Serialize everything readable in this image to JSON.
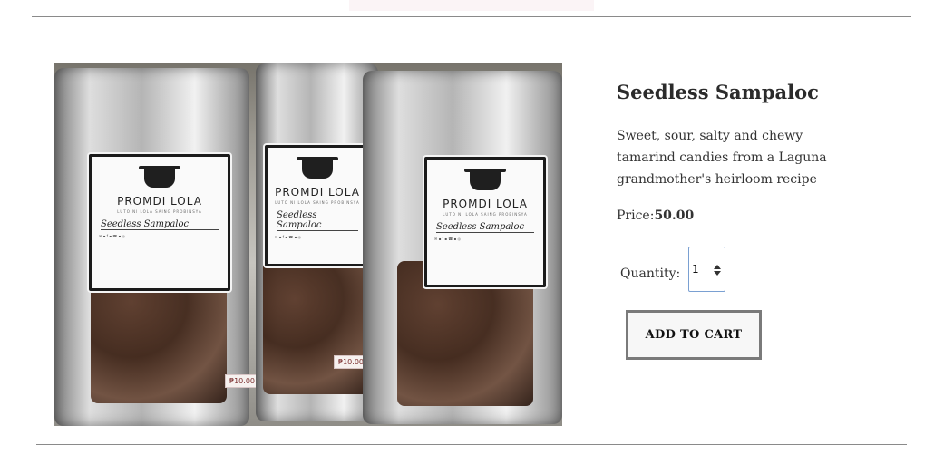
{
  "product": {
    "title": "Seedless Sampaloc",
    "description": "Sweet, sour, salty and chewy tamarind candies from a Laguna grandmother's heirloom recipe",
    "price_label": "Price:",
    "price_value": "50.00",
    "quantity_label": "Quantity:",
    "quantity_value": "1",
    "add_to_cart_label": "ADD TO CART"
  },
  "image": {
    "packages": [
      {
        "brand": "PROMDI LOLA",
        "tagline": "LUTO NI LOLA SAING PROBINSYA",
        "handwritten": "Seedless Sampaloc",
        "price_tag": "₱10.00"
      },
      {
        "brand": "PROMDI LOLA",
        "tagline": "LUTO NI LOLA SAING PROBINSYA",
        "handwritten": "Seedless Sampaloc",
        "price_tag": "₱10.00"
      },
      {
        "brand": "PROMDI LOLA",
        "tagline": "LUTO NI LOLA SAING PROBINSYA",
        "handwritten": "Seedless Sampaloc",
        "price_tag": ""
      }
    ]
  }
}
